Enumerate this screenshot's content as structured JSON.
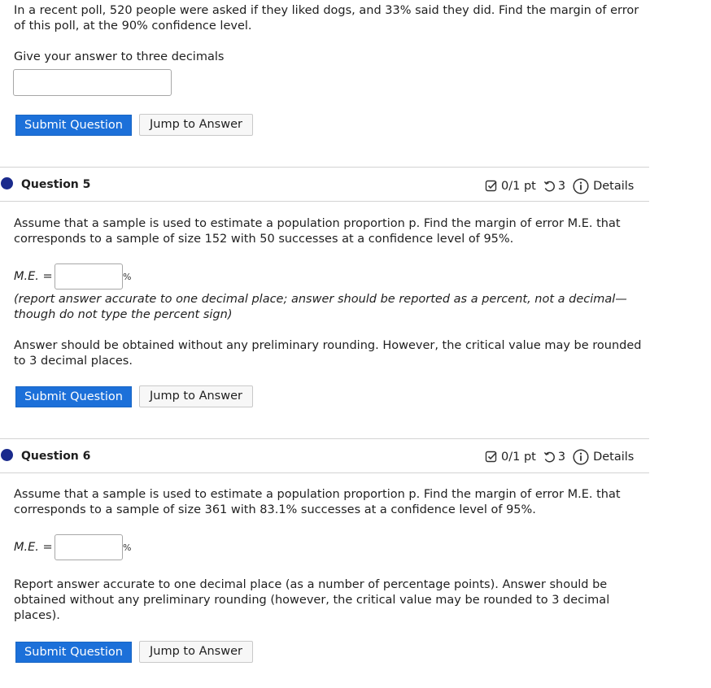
{
  "q4": {
    "line1": "In a recent poll, 520 people were asked if they liked dogs, and 33% said they did. Find the margin of error",
    "line2": "of this poll, at the 90% confidence level.",
    "instruction": "Give your answer to three decimals",
    "answer_value": "",
    "submit_label": "Submit Question",
    "jump_label": "Jump to Answer"
  },
  "q5": {
    "title": "Question 5",
    "score": "0/1 pt",
    "attempts": "3",
    "details_label": "Details",
    "line1": "Assume that a sample is used to estimate a population proportion p. Find the margin of error M.E. that",
    "line2": "corresponds to a sample of size 152 with 50 successes at a confidence level of 95%.",
    "me_label": "M.E. =",
    "answer_value": "",
    "percent_sign": "%",
    "note1": "(report answer accurate to one decimal place; answer should be reported as a percent, not a decimal—",
    "note2": "though do not type the percent sign)",
    "para1": "Answer should be obtained without any preliminary rounding. However, the critical value may be rounded",
    "para2": "to 3 decimal places.",
    "submit_label": "Submit Question",
    "jump_label": "Jump to Answer"
  },
  "q6": {
    "title": "Question 6",
    "score": "0/1 pt",
    "attempts": "3",
    "details_label": "Details",
    "line1": "Assume that a sample is used to estimate a population proportion p. Find the margin of error M.E. that",
    "line2": "corresponds to a sample of size 361 with 83.1% successes at a confidence level of 95%.",
    "me_label": "M.E. =",
    "answer_value": "",
    "percent_sign": "%",
    "para1": "Report answer accurate to one decimal place (as a number of percentage points). Answer should be",
    "para2": "obtained without any preliminary rounding (however, the critical value may be rounded to 3 decimal",
    "para3": "places).",
    "submit_label": "Submit Question",
    "jump_label": "Jump to Answer"
  },
  "icons": {
    "score": "checkbox-icon",
    "attempts": "retry-icon",
    "details": "info-icon"
  },
  "colors": {
    "primary_button": "#1c70d9",
    "question_dot": "#1a2a8c"
  }
}
